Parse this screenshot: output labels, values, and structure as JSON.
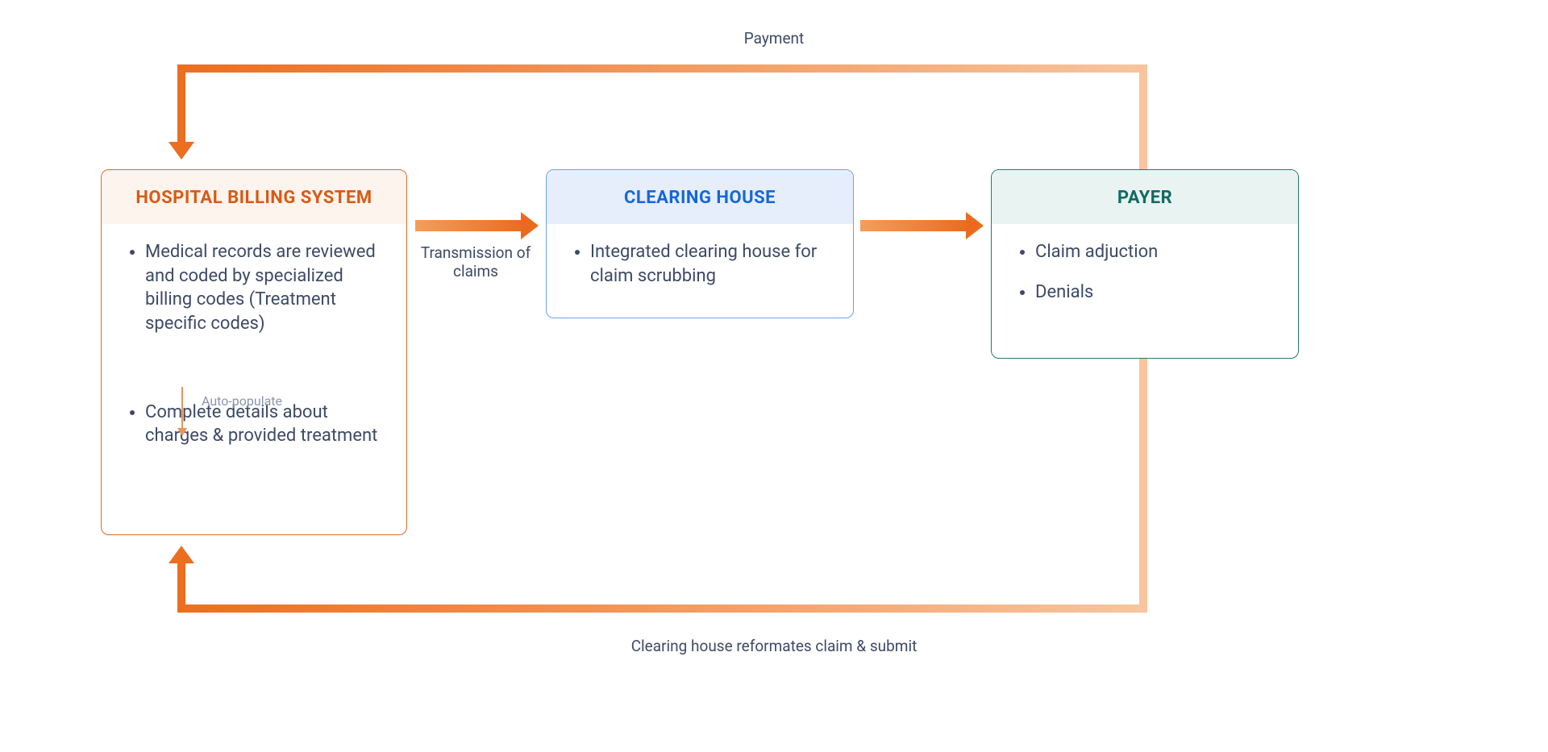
{
  "nodes": {
    "hospital": {
      "title": "HOSPITAL BILLING SYSTEM",
      "item1": "Medical records are reviewed and coded by specialized billing codes (Treatment specific codes)",
      "item2": "Complete details about charges & provided treatment",
      "internal_arrow_label": "Auto-populate"
    },
    "clearing": {
      "title": "CLEARING HOUSE",
      "item1": "Integrated clearing house for claim scrubbing"
    },
    "payer": {
      "title": "PAYER",
      "item1": "Claim adjuction",
      "item2": "Denials"
    }
  },
  "edges": {
    "payment": "Payment",
    "transmission": "Transmission of claims",
    "reformat": "Clearing house reformates claim & submit"
  },
  "colors": {
    "hospital_border": "#E06A1F",
    "hospital_header_bg": "#FEF4EE",
    "hospital_header_text": "#D95A13",
    "clearing_border": "#6FA0E8",
    "clearing_header_bg": "#E7EEFB",
    "clearing_header_text": "#1467D9",
    "payer_border": "#28796F",
    "payer_header_bg": "#E8F3F2",
    "payer_header_text": "#0F6B61",
    "arrow_dark": "#EC6E20",
    "arrow_light": "#F8C59E",
    "body_text": "#3d4a66"
  }
}
